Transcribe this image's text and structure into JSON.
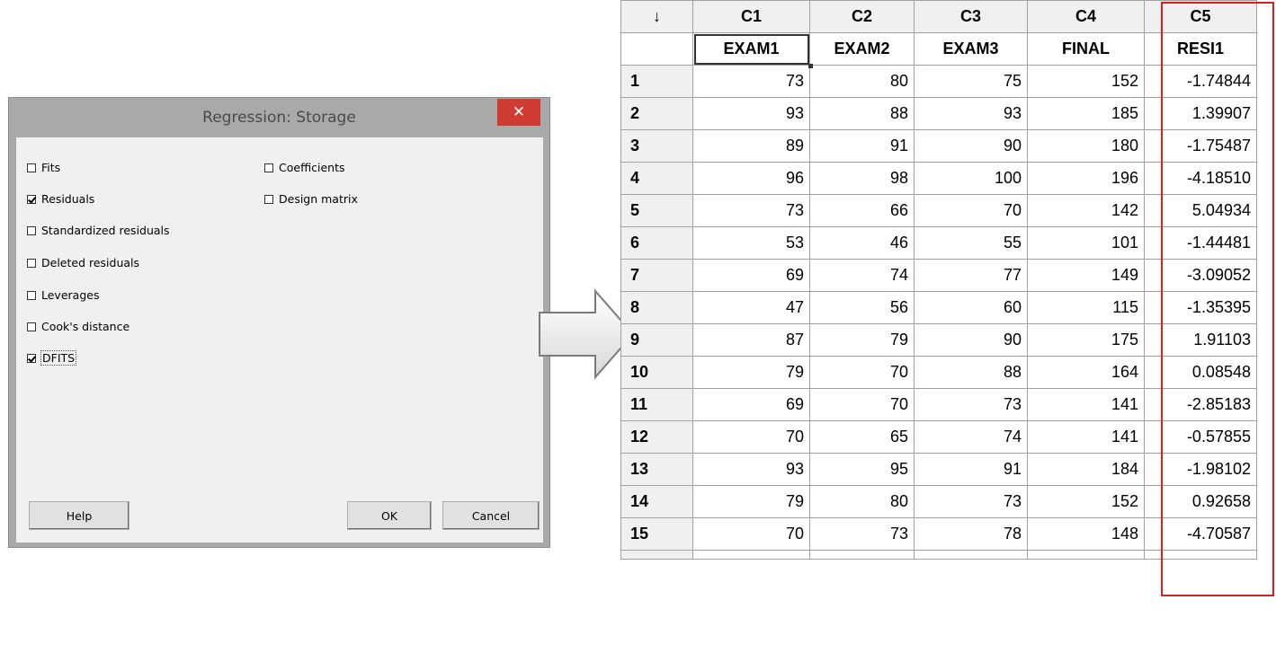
{
  "dialog": {
    "title": "Regression: Storage",
    "close_glyph": "✕",
    "options_left": [
      {
        "label": "Fits",
        "checked": false,
        "name": "fits"
      },
      {
        "label": "Residuals",
        "checked": true,
        "name": "residuals"
      },
      {
        "label": "Standardized residuals",
        "checked": false,
        "name": "standardized-residuals"
      },
      {
        "label": "Deleted residuals",
        "checked": false,
        "name": "deleted-residuals"
      },
      {
        "label": "Leverages",
        "checked": false,
        "name": "leverages"
      },
      {
        "label": "Cook's distance",
        "checked": false,
        "name": "cooks-distance"
      },
      {
        "label": "DFITS",
        "checked": true,
        "name": "dfits"
      }
    ],
    "options_right": [
      {
        "label": "Coefficients",
        "checked": false,
        "name": "coefficients"
      },
      {
        "label": "Design matrix",
        "checked": false,
        "name": "design-matrix"
      }
    ],
    "buttons": {
      "help": "Help",
      "ok": "OK",
      "cancel": "Cancel"
    },
    "colors": {
      "close": "#cf3a33",
      "frame": "#a9a9a9",
      "client": "#f0f0f0"
    }
  },
  "worksheet": {
    "corner": "↓",
    "columns": [
      "C1",
      "C2",
      "C3",
      "C4",
      "C5"
    ],
    "names": [
      "EXAM1",
      "EXAM2",
      "EXAM3",
      "FINAL",
      "RESI1"
    ],
    "rows": [
      [
        "1",
        "73",
        "80",
        "75",
        "152",
        "-1.74844"
      ],
      [
        "2",
        "93",
        "88",
        "93",
        "185",
        "1.39907"
      ],
      [
        "3",
        "89",
        "91",
        "90",
        "180",
        "-1.75487"
      ],
      [
        "4",
        "96",
        "98",
        "100",
        "196",
        "-4.18510"
      ],
      [
        "5",
        "73",
        "66",
        "70",
        "142",
        "5.04934"
      ],
      [
        "6",
        "53",
        "46",
        "55",
        "101",
        "-1.44481"
      ],
      [
        "7",
        "69",
        "74",
        "77",
        "149",
        "-3.09052"
      ],
      [
        "8",
        "47",
        "56",
        "60",
        "115",
        "-1.35395"
      ],
      [
        "9",
        "87",
        "79",
        "90",
        "175",
        "1.91103"
      ],
      [
        "10",
        "79",
        "70",
        "88",
        "164",
        "0.08548"
      ],
      [
        "11",
        "69",
        "70",
        "73",
        "141",
        "-2.85183"
      ],
      [
        "12",
        "70",
        "65",
        "74",
        "141",
        "-0.57855"
      ],
      [
        "13",
        "93",
        "95",
        "91",
        "184",
        "-1.98102"
      ],
      [
        "14",
        "79",
        "80",
        "73",
        "152",
        "0.92658"
      ],
      [
        "15",
        "70",
        "73",
        "78",
        "148",
        "-4.70587"
      ]
    ],
    "highlight_color": "#e01c1c"
  },
  "arrow_icon": "right-arrow-icon"
}
